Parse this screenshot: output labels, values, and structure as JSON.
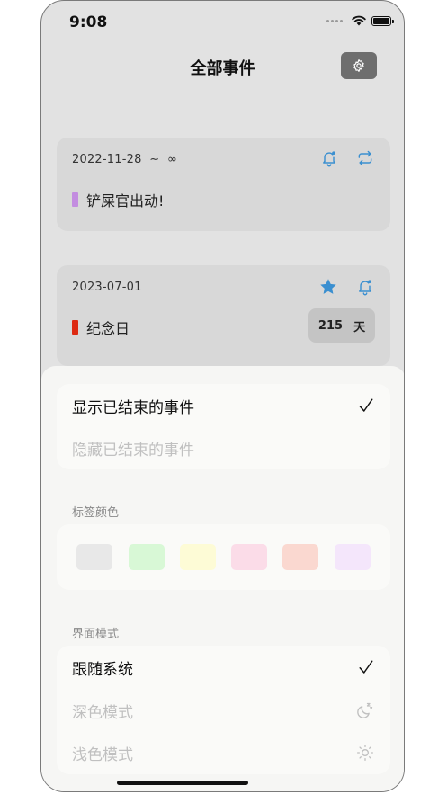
{
  "status_bar": {
    "time": "9:08"
  },
  "header": {
    "title": "全部事件",
    "settings_icon": "gear-icon"
  },
  "events": [
    {
      "date_range": "2022-11-28  ~  ∞",
      "title": "铲屎官出动!",
      "tag_color": "#c38de0",
      "icons": [
        "bell-icon",
        "repeat-icon"
      ]
    },
    {
      "date_range": "2023-07-01",
      "title": "纪念日",
      "tag_color": "#dd2a12",
      "icons": [
        "star-icon",
        "bell-icon"
      ],
      "days_count": "215",
      "days_unit": "天"
    }
  ],
  "sheet": {
    "ended_events": {
      "options": [
        {
          "label": "显示已结束的事件",
          "selected": true
        },
        {
          "label": "隐藏已结束的事件",
          "selected": false
        }
      ]
    },
    "tag_colors": {
      "label": "标签颜色",
      "swatches": [
        "#e8e8e8",
        "#d8f8d6",
        "#fdfbd6",
        "#fbdce8",
        "#fad8d0",
        "#f4e6fb"
      ]
    },
    "appearance": {
      "label": "界面模式",
      "options": [
        {
          "label": "跟随系统",
          "selected": true,
          "icon": "checkmark-icon"
        },
        {
          "label": "深色模式",
          "selected": false,
          "icon": "moon-icon"
        },
        {
          "label": "浅色模式",
          "selected": false,
          "icon": "sun-icon"
        }
      ]
    }
  },
  "colors": {
    "accent_icon": "#3a8fd0",
    "check": "#111111"
  }
}
